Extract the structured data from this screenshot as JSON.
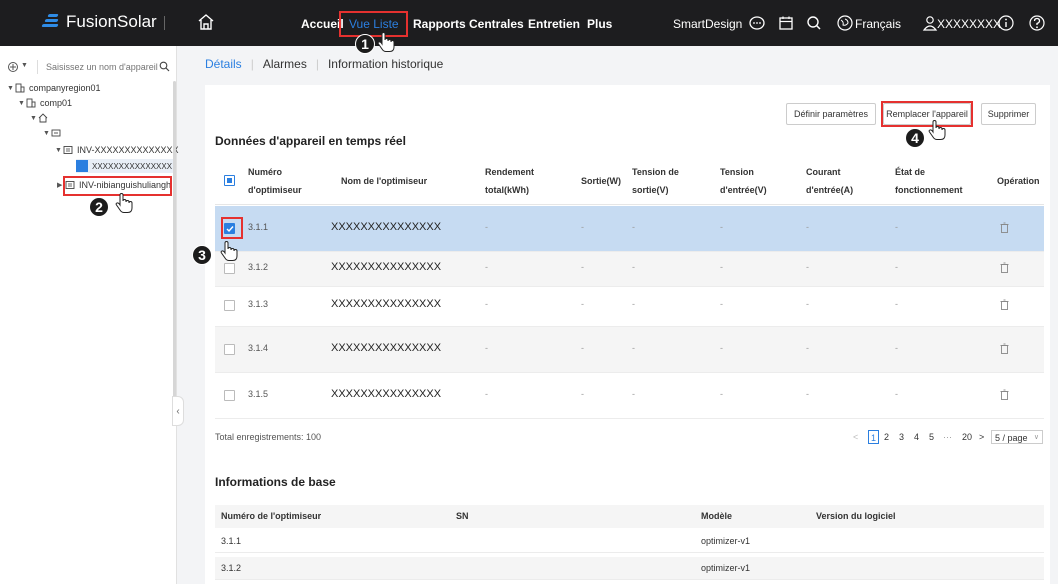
{
  "topbar": {
    "brand": "FusionSolar",
    "nav": [
      "Accueil",
      "Vue Liste",
      "Rapports",
      "Centrales",
      "Entretien",
      "Plus"
    ],
    "active_nav": "Vue Liste",
    "smart_design": "SmartDesign",
    "language": "Français",
    "user": "XXXXXXXX"
  },
  "sidebar": {
    "search_placeholder": "Saisissez un nom d'appareil",
    "tree": [
      {
        "label": "companyregion01",
        "level": 0
      },
      {
        "label": "comp01",
        "level": 1
      },
      {
        "label": "",
        "level": 2
      },
      {
        "label": "",
        "level": 3
      },
      {
        "label": "INV-XXXXXXXXXXXXXX",
        "level": 4
      },
      {
        "label": "XXXXXXXXXXXXXXX",
        "level": 5
      },
      {
        "label": "INV-nibianguishuliangh",
        "level": 4
      }
    ]
  },
  "tabs": [
    "Détails",
    "Alarmes",
    "Information historique"
  ],
  "active_tab": "Détails",
  "buttons": {
    "set_params": "Définir paramètres",
    "replace": "Remplacer l'appareil",
    "delete": "Supprimer"
  },
  "realtime": {
    "title": "Données d'appareil en temps réel",
    "columns": {
      "num": "Numéro\nd'optimiseur",
      "name": "Nom de l'optimiseur",
      "yield": "Rendement\ntotal(kWh)",
      "output": "Sortie(W)",
      "vout": "Tension de\nsortie(V)",
      "vin": "Tension\nd'entrée(V)",
      "iin": "Courant\nd'entrée(A)",
      "state": "État de\nfonctionnement",
      "op": "Opération"
    },
    "rows": [
      {
        "num": "3.1.1",
        "name": "XXXXXXXXXXXXXXX",
        "yield": "-",
        "output": "-",
        "vout": "-",
        "vin": "-",
        "iin": "-",
        "state": "-"
      },
      {
        "num": "3.1.2",
        "name": "XXXXXXXXXXXXXXX",
        "yield": "-",
        "output": "-",
        "vout": "-",
        "vin": "-",
        "iin": "-",
        "state": "-"
      },
      {
        "num": "3.1.3",
        "name": "XXXXXXXXXXXXXXX",
        "yield": "-",
        "output": "-",
        "vout": "-",
        "vin": "-",
        "iin": "-",
        "state": "-"
      },
      {
        "num": "3.1.4",
        "name": "XXXXXXXXXXXXXXX",
        "yield": "-",
        "output": "-",
        "vout": "-",
        "vin": "-",
        "iin": "-",
        "state": "-"
      },
      {
        "num": "3.1.5",
        "name": "XXXXXXXXXXXXXXX",
        "yield": "-",
        "output": "-",
        "vout": "-",
        "vin": "-",
        "iin": "-",
        "state": "-"
      }
    ],
    "total": "Total enregistrements: 100",
    "pages": [
      "1",
      "2",
      "3",
      "4",
      "5",
      "···",
      "20"
    ],
    "page_size": "5 / page"
  },
  "base": {
    "title": "Informations de base",
    "columns": [
      "Numéro de l'optimiseur",
      "SN",
      "Modèle",
      "Version du logiciel"
    ],
    "rows": [
      [
        "3.1.1",
        "",
        "optimizer-v1",
        ""
      ],
      [
        "3.1.2",
        "",
        "optimizer-v1",
        ""
      ]
    ]
  },
  "steps": [
    "1",
    "2",
    "3",
    "4"
  ],
  "colors": {
    "accent": "#2b7fe0",
    "highlight": "#e5312f",
    "topbar": "#1d1d1f",
    "selected_row": "#c6dbf2"
  }
}
